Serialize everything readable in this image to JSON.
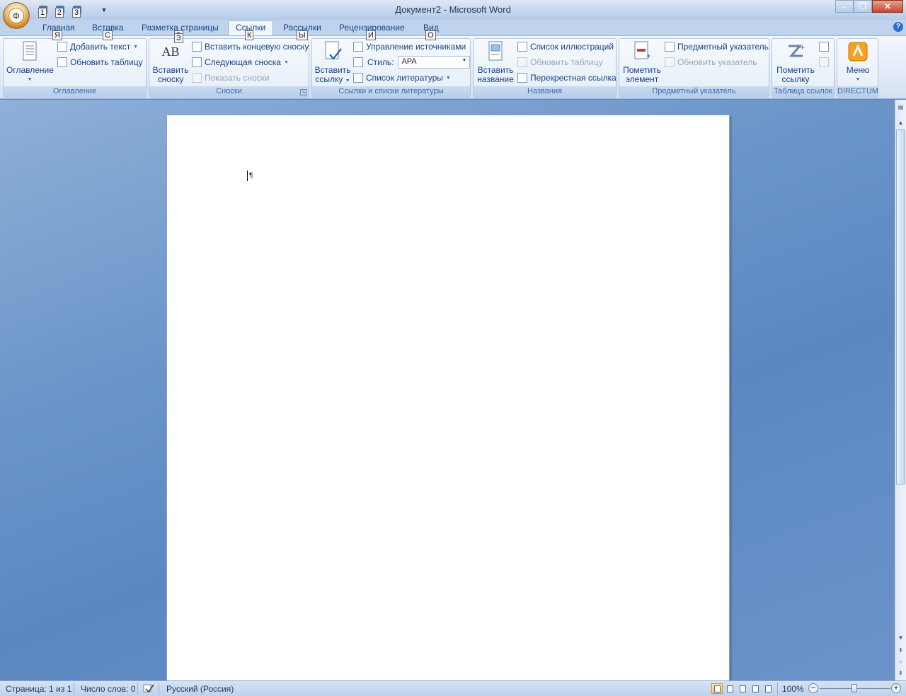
{
  "window": {
    "title": "Документ2 - Microsoft Word",
    "orb_letter": "Ф",
    "qat_keytips": [
      "1",
      "2",
      "3"
    ]
  },
  "tabs": [
    {
      "label": "Главная",
      "keytip": "Я"
    },
    {
      "label": "Вставка",
      "keytip": "С"
    },
    {
      "label": "Разметка страницы",
      "keytip": "З"
    },
    {
      "label": "Ссылки",
      "keytip": "К",
      "active": true
    },
    {
      "label": "Рассылки",
      "keytip": "Ы"
    },
    {
      "label": "Рецензирование",
      "keytip": "И"
    },
    {
      "label": "Вид",
      "keytip": "О"
    }
  ],
  "help_glyph": "?",
  "ribbon": {
    "toc": {
      "label": "Оглавление",
      "big_button": "Оглавление",
      "add_text": "Добавить текст",
      "update_table": "Обновить таблицу"
    },
    "footnotes": {
      "label": "Сноски",
      "insert_footnote": "Вставить сноску",
      "insert_footnote_line1": "Вставить",
      "insert_footnote_line2": "сноску",
      "insert_endnote": "Вставить концевую сноску",
      "next_footnote": "Следующая сноска",
      "show_notes": "Показать сноски",
      "icon_text": "AB"
    },
    "citations": {
      "label": "Ссылки и списки литературы",
      "insert_citation_line1": "Вставить",
      "insert_citation_line2": "ссылку",
      "manage_sources": "Управление источниками",
      "style_label": "Стиль:",
      "style_value": "APA",
      "bibliography": "Список литературы"
    },
    "captions": {
      "label": "Названия",
      "insert_caption_line1": "Вставить",
      "insert_caption_line2": "название",
      "table_of_figures": "Список иллюстраций",
      "update_table": "Обновить таблицу",
      "cross_reference": "Перекрестная ссылка"
    },
    "index": {
      "label": "Предметный указатель",
      "mark_entry_line1": "Пометить",
      "mark_entry_line2": "элемент",
      "insert_index": "Предметный указатель",
      "update_index": "Обновить указатель"
    },
    "authorities": {
      "label": "Таблица ссылок",
      "mark_citation_line1": "Пометить",
      "mark_citation_line2": "ссылку"
    },
    "directum": {
      "label": "DIRECTUM",
      "menu": "Меню"
    }
  },
  "document": {
    "pilcrow": "¶"
  },
  "statusbar": {
    "page": "Страница: 1 из 1",
    "words": "Число слов: 0",
    "language": "Русский (Россия)",
    "zoom": "100%",
    "zoom_level_percent": 100
  },
  "colors": {
    "ribbon_text": "#15428b",
    "accent_active_view": "#f9c55d"
  }
}
